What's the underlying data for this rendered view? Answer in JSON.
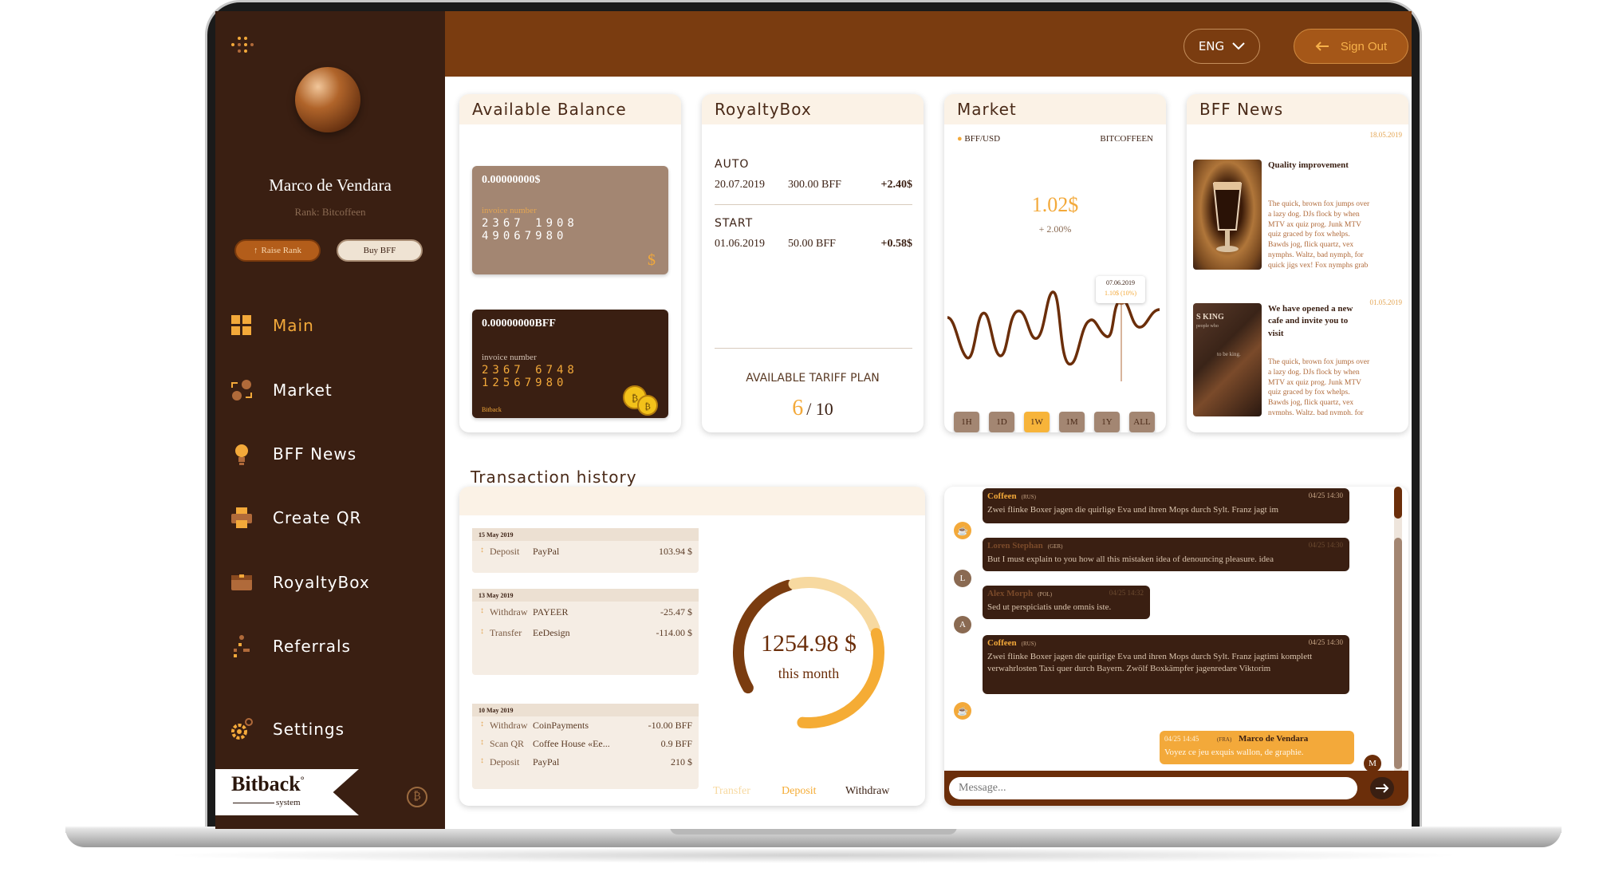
{
  "user": {
    "name": "Marco de Vendara",
    "rank": "Rank: Bitcoffeen",
    "raise_rank": "Raise Rank",
    "buy_bff": "Buy BFF"
  },
  "nav": [
    {
      "label": "Main",
      "icon": "grid-icon"
    },
    {
      "label": "Market",
      "icon": "exchange-icon"
    },
    {
      "label": "BFF News",
      "icon": "bulb-icon"
    },
    {
      "label": "Create QR",
      "icon": "printer-icon"
    },
    {
      "label": "RoyaltyBox",
      "icon": "box-icon"
    },
    {
      "label": "Referrals",
      "icon": "referrals-icon"
    },
    {
      "label": "Settings",
      "icon": "gear-icon"
    }
  ],
  "brand": {
    "name": "Bitback",
    "mark": "°",
    "sub": "system"
  },
  "header": {
    "lang": "ENG",
    "signout": "Sign Out"
  },
  "balance": {
    "title": "Available Balance",
    "card1": {
      "amount": "0.00000000$",
      "invoice_label": "invoice number",
      "invoice_number": "2367 1908 49067980",
      "currency": "$"
    },
    "card2": {
      "amount": "0.00000000BFF",
      "invoice_label": "invoice number",
      "invoice_number": "2367 6748 12567980",
      "brand": "Bitback"
    }
  },
  "royalty": {
    "title": "RoyaltyBox",
    "auto": {
      "label": "AUTO",
      "date": "20.07.2019",
      "amount": "300.00 BFF",
      "change": "+2.40$"
    },
    "start": {
      "label": "START",
      "date": "01.06.2019",
      "amount": "50.00 BFF",
      "change": "+0.58$"
    },
    "tariff_label": "AVAILABLE TARIFF PLAN",
    "tariff_value": "6",
    "tariff_total": "/ 10"
  },
  "market": {
    "title": "Market",
    "pair": "BFF/USD",
    "brand": "BITCOFFEEN",
    "price": "1.02$",
    "change": "+ 2.00%",
    "tooltip_date": "07.06.2019",
    "tooltip_value": "1.10$ (10%)",
    "timeframes": [
      "1H",
      "1D",
      "1W",
      "1M",
      "1Y",
      "ALL"
    ],
    "active_timeframe": "1W"
  },
  "news": {
    "title": "BFF News",
    "items": [
      {
        "date": "18.05.2019",
        "title": "Quality improvement",
        "text": "The quick, brown fox jumps over a lazy dog. DJs flock by when MTV ax quiz prog. Junk MTV quiz graced by fox whelps. Bawds jog, flick quartz, vex nymphs. Waltz, bad nymph, for quick jigs vex! Fox nymphs grab"
      },
      {
        "date": "01.05.2019",
        "title": "We have opened a new cafe and invite you to visit",
        "text": "The quick, brown fox jumps over a lazy dog. DJs flock by when MTV ax quiz prog. Junk MTV quiz graced by fox whelps. Bawds jog, flick quartz, vex nymphs. Waltz, bad nymph, for",
        "img_text1": "S KING",
        "img_text2": "people who",
        "img_text3": "to be king."
      }
    ]
  },
  "transactions": {
    "title": "Transaction history",
    "groups": [
      {
        "date": "15 May 2019",
        "rows": [
          {
            "type": "Deposit",
            "name": "PayPal",
            "amount": "103.94 $"
          }
        ]
      },
      {
        "date": "13 May 2019",
        "rows": [
          {
            "type": "Withdraw",
            "name": "PAYEER",
            "amount": "-25.47 $"
          },
          {
            "type": "Transfer",
            "name": "EeDesign",
            "amount": "-114.00 $"
          }
        ]
      },
      {
        "date": "10 May 2019",
        "rows": [
          {
            "type": "Withdraw",
            "name": "CoinPayments",
            "amount": "-10.00 BFF"
          },
          {
            "type": "Scan QR",
            "name": "Coffee House «Ee...",
            "amount": "0.9 BFF"
          },
          {
            "type": "Deposit",
            "name": "PayPal",
            "amount": "210 $"
          }
        ]
      }
    ],
    "total": "1254.98 $",
    "total_label": "this month",
    "tabs": [
      "Transfer",
      "Deposit",
      "Withdraw"
    ],
    "ring": {
      "transfer": 0.24,
      "deposit": 0.32,
      "withdraw": 0.3
    },
    "colors": {
      "transfer": "#f7d9a0",
      "deposit": "#f5ac35",
      "withdraw": "#7a3c10"
    }
  },
  "chat": {
    "messages": [
      {
        "author": "Coffeen",
        "country": "(RUS)",
        "time": "04/25 14:30",
        "text": "Zwei flinke Boxer jagen die quirlige Eva und ihren Mops durch Sylt. Franz jagt im",
        "avatar": "☕"
      },
      {
        "author": "Loren Stephan",
        "country": "(GER)",
        "time": "04/25 14:30",
        "text": "But I must explain to you how all this mistaken idea of denouncing pleasure. idea",
        "avatar": "L"
      },
      {
        "author": "Alex Morph",
        "country": "(POL)",
        "time": "04/25 14:32",
        "text": "Sed ut perspiciatis unde omnis iste.",
        "avatar": "A"
      },
      {
        "author": "Coffeen",
        "country": "(RUS)",
        "time": "04/25 14:30",
        "text": "Zwei flinke Boxer jagen die quirlige Eva und ihren Mops durch Sylt. Franz jagtimi komplett verwahrlosten Taxi quer durch Bayern. Zwölf Boxkämpfer jagenredare Viktorim",
        "avatar": "☕"
      },
      {
        "author": "Marco de Vendara",
        "country": "(FRA)",
        "time": "04/25 14:45",
        "text": "Voyez ce jeu exquis wallon, de graphie.",
        "avatar": "M"
      }
    ],
    "placeholder": "Message..."
  },
  "colors": {
    "sidebar": "#3a1f12",
    "topbar": "#7a3c10",
    "accent": "#f3a93a",
    "tan": "#a38672"
  }
}
